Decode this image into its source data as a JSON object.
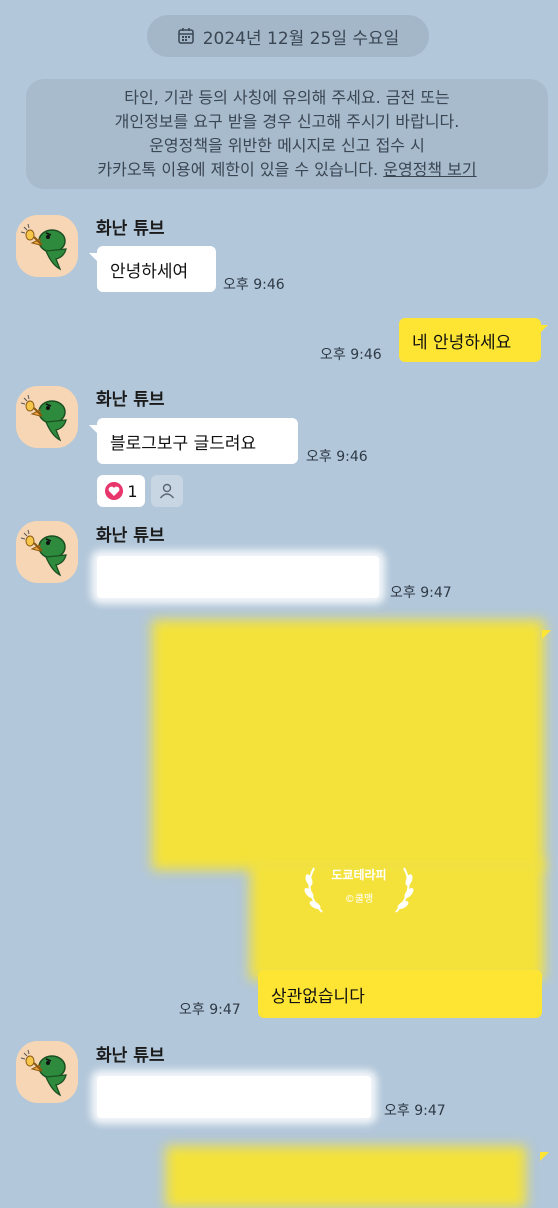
{
  "date_label": "2024년 12월 25일 수요일",
  "notice": {
    "line1": "타인, 기관 등의 사칭에 유의해 주세요. 금전 또는",
    "line2": "개인정보를 요구 받을 경우 신고해 주시기 바랍니다.",
    "line3": "운영정책을 위반한 메시지로 신고 접수 시",
    "line4_prefix": "카카오톡 이용에 제한이 있을 수 있습니다. ",
    "link": "운영정책 보기"
  },
  "sender_name": "화난 튜브",
  "messages": [
    {
      "side": "in",
      "text": "안녕하세여",
      "time": "오후 9:46"
    },
    {
      "side": "out",
      "text": "네 안녕하세요",
      "time": "오후 9:46"
    },
    {
      "side": "in",
      "text": "블로그보구 글드려요",
      "time": "오후 9:46",
      "reaction_count": "1"
    },
    {
      "side": "in",
      "text": "",
      "time": "오후 9:47"
    },
    {
      "side": "out",
      "text": "상관없습니다",
      "time": "오후 9:47"
    },
    {
      "side": "in",
      "text": "",
      "time": "오후 9:47"
    }
  ],
  "watermark": {
    "line1": "도쿄테라피",
    "line2": "©쿨맹"
  },
  "colors": {
    "background": "#b2c7da",
    "out_bubble": "#fee533",
    "in_bubble": "#ffffff",
    "reaction_heart": "#e8356b"
  }
}
